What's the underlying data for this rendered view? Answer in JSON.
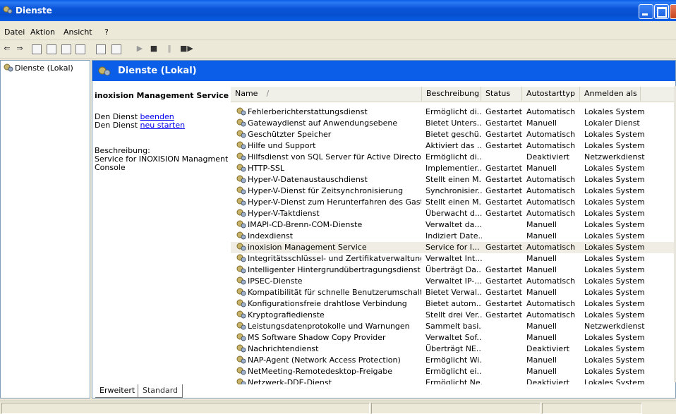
{
  "window": {
    "title": "Dienste"
  },
  "menu": {
    "items": [
      "Datei",
      "Aktion",
      "Ansicht",
      "?"
    ]
  },
  "toolbar": {
    "icons": [
      "back-icon",
      "forward-icon",
      "console-tree-icon",
      "properties-icon",
      "refresh-icon",
      "export-icon",
      "help-icon",
      "view-icon",
      "play-icon",
      "stop-icon",
      "pause-icon",
      "restart-icon"
    ]
  },
  "tree": {
    "root_label": "Dienste (Lokal)"
  },
  "banner": {
    "title": "Dienste (Lokal)"
  },
  "detail": {
    "service_name": "inoxision Management Service",
    "stop_prefix": "Den Dienst ",
    "stop_link": "beenden",
    "restart_prefix": "Den Dienst ",
    "restart_link": "neu starten",
    "desc_label": "Beschreibung:",
    "desc_text_1": "Service for INOXISION Managment",
    "desc_text_2": "Console"
  },
  "columns": {
    "name": "Name",
    "sort_indicator": "/",
    "beschreibung": "Beschreibung",
    "status": "Status",
    "autostarttyp": "Autostarttyp",
    "anmelden_als": "Anmelden als"
  },
  "rows": [
    {
      "name": "Fehlerberichterstattungsdienst",
      "desc": "Ermöglicht di...",
      "status": "Gestartet",
      "start": "Automatisch",
      "logon": "Lokales System"
    },
    {
      "name": "Gatewaydienst auf Anwendungsebene",
      "desc": "Bietet Unters...",
      "status": "Gestartet",
      "start": "Manuell",
      "logon": "Lokaler Dienst"
    },
    {
      "name": "Geschützter Speicher",
      "desc": "Bietet geschü...",
      "status": "Gestartet",
      "start": "Automatisch",
      "logon": "Lokales System"
    },
    {
      "name": "Hilfe und Support",
      "desc": "Aktiviert das ...",
      "status": "Gestartet",
      "start": "Automatisch",
      "logon": "Lokales System"
    },
    {
      "name": "Hilfsdienst von SQL Server für Active Directory",
      "desc": "Ermöglicht di...",
      "status": "",
      "start": "Deaktiviert",
      "logon": "Netzwerkdienst"
    },
    {
      "name": "HTTP-SSL",
      "desc": "Implementier...",
      "status": "Gestartet",
      "start": "Manuell",
      "logon": "Lokales System"
    },
    {
      "name": "Hyper-V-Datenaustauschdienst",
      "desc": "Stellt einen M...",
      "status": "Gestartet",
      "start": "Automatisch",
      "logon": "Lokales System"
    },
    {
      "name": "Hyper-V-Dienst für Zeitsynchronisierung",
      "desc": "Synchronisier...",
      "status": "Gestartet",
      "start": "Automatisch",
      "logon": "Lokales System"
    },
    {
      "name": "Hyper-V-Dienst zum Herunterfahren des Gasts",
      "desc": "Stellt einen M...",
      "status": "Gestartet",
      "start": "Automatisch",
      "logon": "Lokales System"
    },
    {
      "name": "Hyper-V-Taktdienst",
      "desc": "Überwacht d...",
      "status": "Gestartet",
      "start": "Automatisch",
      "logon": "Lokales System"
    },
    {
      "name": "IMAPI-CD-Brenn-COM-Dienste",
      "desc": "Verwaltet da...",
      "status": "",
      "start": "Manuell",
      "logon": "Lokales System"
    },
    {
      "name": "Indexdienst",
      "desc": "Indiziert Date...",
      "status": "",
      "start": "Manuell",
      "logon": "Lokales System"
    },
    {
      "name": "inoxision Management Service",
      "desc": "Service for I...",
      "status": "Gestartet",
      "start": "Automatisch",
      "logon": "Lokales System"
    },
    {
      "name": "Integritätsschlüssel- und Zertifikatverwaltungsdienst",
      "desc": "Verwaltet Int...",
      "status": "",
      "start": "Manuell",
      "logon": "Lokales System"
    },
    {
      "name": "Intelligenter Hintergrundübertragungsdienst",
      "desc": "Überträgt Da...",
      "status": "Gestartet",
      "start": "Manuell",
      "logon": "Lokales System"
    },
    {
      "name": "IPSEC-Dienste",
      "desc": "Verwaltet IP-...",
      "status": "Gestartet",
      "start": "Automatisch",
      "logon": "Lokales System"
    },
    {
      "name": "Kompatibilität für schnelle Benutzerumschaltung",
      "desc": "Bietet Verwal...",
      "status": "Gestartet",
      "start": "Manuell",
      "logon": "Lokales System"
    },
    {
      "name": "Konfigurationsfreie drahtlose Verbindung",
      "desc": "Bietet autom...",
      "status": "Gestartet",
      "start": "Automatisch",
      "logon": "Lokales System"
    },
    {
      "name": "Kryptografiedienste",
      "desc": "Stellt drei Ver...",
      "status": "Gestartet",
      "start": "Automatisch",
      "logon": "Lokales System"
    },
    {
      "name": "Leistungsdatenprotokolle und Warnungen",
      "desc": "Sammelt basi...",
      "status": "",
      "start": "Manuell",
      "logon": "Netzwerkdienst"
    },
    {
      "name": "MS Software Shadow Copy Provider",
      "desc": "Verwaltet Sof...",
      "status": "",
      "start": "Manuell",
      "logon": "Lokales System"
    },
    {
      "name": "Nachrichtendienst",
      "desc": "Überträgt NE...",
      "status": "",
      "start": "Deaktiviert",
      "logon": "Lokales System"
    },
    {
      "name": "NAP-Agent (Network Access Protection)",
      "desc": "Ermöglicht Wi...",
      "status": "",
      "start": "Manuell",
      "logon": "Lokales System"
    },
    {
      "name": "NetMeeting-Remotedesktop-Freigabe",
      "desc": "Ermöglicht ei...",
      "status": "",
      "start": "Manuell",
      "logon": "Lokales System"
    },
    {
      "name": "Netzwerk-DDE-Dienst",
      "desc": "Ermöglicht Ne...",
      "status": "",
      "start": "Deaktiviert",
      "logon": "Lokales System"
    }
  ],
  "selected_index": 12,
  "tabs": {
    "extended": "Erweitert",
    "standard": "Standard"
  },
  "colors": {
    "titlebar": "#0a5ee8",
    "banner": "#0a5ee8",
    "link": "#0000ee",
    "selection": "#f0eee4"
  }
}
